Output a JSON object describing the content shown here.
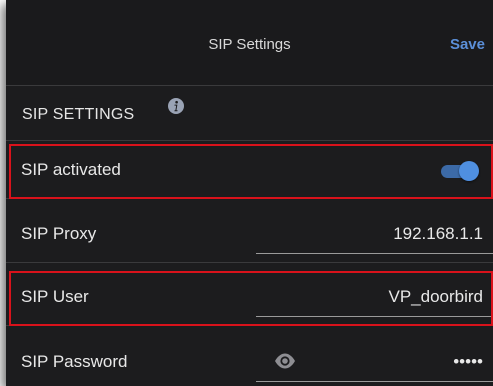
{
  "header": {
    "title": "SIP Settings",
    "save_label": "Save"
  },
  "section": {
    "title": "SIP SETTINGS",
    "info_icon": "info-icon"
  },
  "rows": {
    "sip_activated": {
      "label": "SIP activated",
      "toggle_on": true
    },
    "sip_proxy": {
      "label": "SIP Proxy",
      "value": "192.168.1.1"
    },
    "sip_user": {
      "label": "SIP User",
      "value": "VP_doorbird"
    },
    "sip_password": {
      "label": "SIP Password",
      "value": "•••••",
      "eye_icon": "eye-icon"
    }
  },
  "colors": {
    "accent": "#5b8fd8",
    "highlight": "#d9121b",
    "background": "#1c1c1e"
  }
}
